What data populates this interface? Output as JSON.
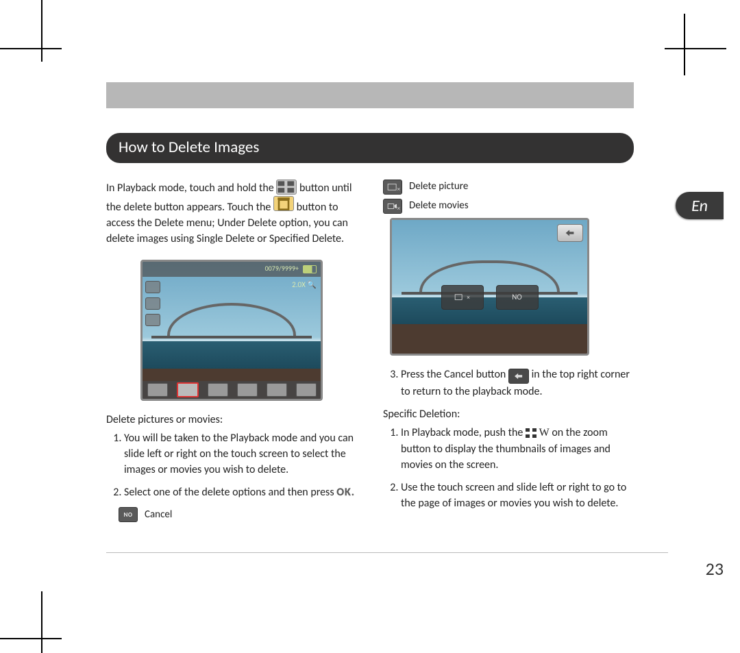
{
  "language_tab": "En",
  "page_number": "23",
  "section_title": "How to Delete Images",
  "intro": {
    "part1": "In Playback mode, touch and hold the",
    "part2": "button until the delete button appears. Touch the",
    "part3": "button to access the Delete menu; Under Delete option, you can delete images using Single Delete or Specified Delete."
  },
  "screen1": {
    "counter": "0079/9999+",
    "zoom": "2.0X"
  },
  "left": {
    "subhead": "Delete pictures or movies:",
    "step1": "You will be taken to the Playback mode and you can slide left or right on the touch screen to select the images or movies you wish to delete.",
    "step2": "Select one of the delete options and then press",
    "ok_label": "OK.",
    "legend_cancel": "Cancel"
  },
  "right": {
    "legend_picture": "Delete picture",
    "legend_movies": "Delete movies",
    "screen2_no": "NO",
    "step3_a": "Press the Cancel button",
    "step3_b": "in the top right corner to return to the playback mode.",
    "specific_head": "Specific Deletion:",
    "spec1_a": "In Playback mode, push the",
    "spec1_w": "W",
    "spec1_b": "on the zoom button to display the thumbnails of images and movies on the screen.",
    "spec2": "Use the touch screen and slide left or right to go to the page of images or movies you wish to delete."
  }
}
